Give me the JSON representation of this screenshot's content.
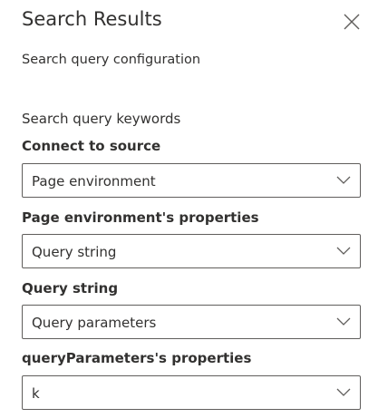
{
  "panel": {
    "title": "Search Results",
    "close_icon": "close-icon"
  },
  "section": {
    "title": "Search query configuration"
  },
  "keywords": {
    "heading": "Search query keywords",
    "fields": [
      {
        "label": "Connect to source",
        "value": "Page environment",
        "icon": "chevron-down-icon"
      },
      {
        "label": "Page environment's properties",
        "value": "Query string",
        "icon": "chevron-down-icon"
      },
      {
        "label": "Query string",
        "value": "Query parameters",
        "icon": "chevron-down-icon"
      },
      {
        "label": "queryParameters's properties",
        "value": "k",
        "icon": "chevron-down-icon"
      }
    ]
  }
}
